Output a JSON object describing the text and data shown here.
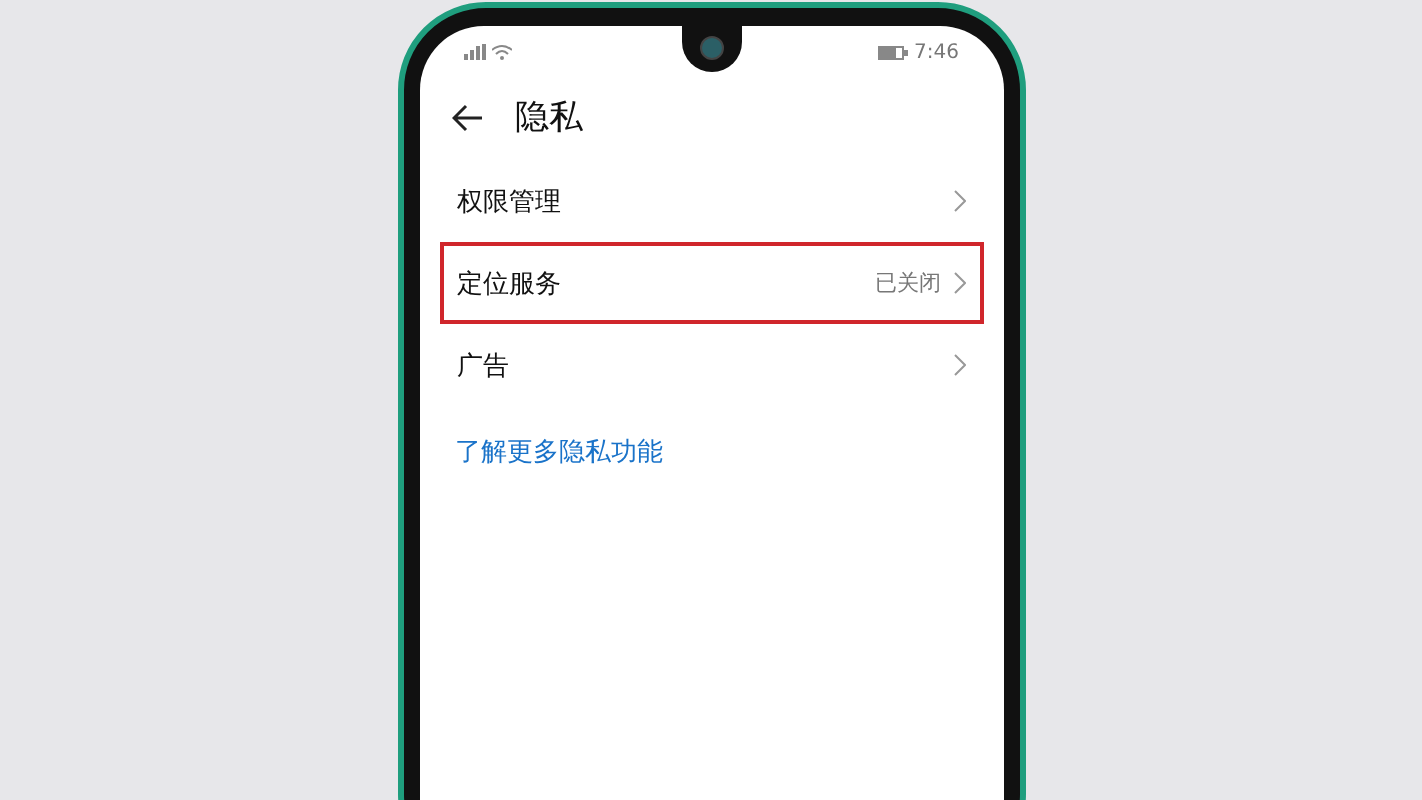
{
  "status_bar": {
    "time": "7:46"
  },
  "header": {
    "title": "隐私"
  },
  "items": [
    {
      "label": "权限管理",
      "highlighted": false
    },
    {
      "label": "定位服务",
      "value": "已关闭",
      "highlighted": true
    },
    {
      "label": "广告",
      "highlighted": false
    }
  ],
  "link": "了解更多隐私功能"
}
